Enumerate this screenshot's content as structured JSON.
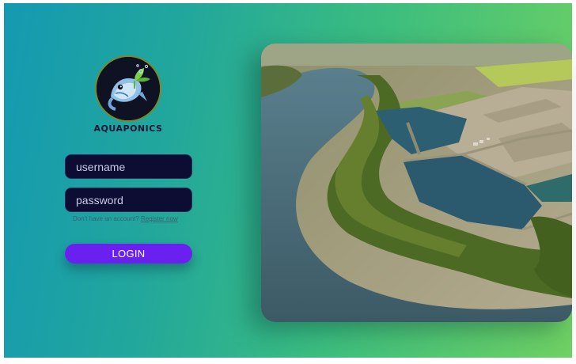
{
  "brand": {
    "name": "AQUAPONICS",
    "logo_icon": "fish-plant-logo-icon"
  },
  "login_form": {
    "username_placeholder": "username",
    "password_placeholder": "password",
    "register_prompt": "Don't have an account?",
    "register_link": "Register now",
    "login_label": "LOGIN"
  },
  "hero_image": {
    "subject": "aerial-aquaculture-ponds"
  },
  "colors": {
    "login_button": "#6a21f0",
    "input_bg": "#0d0c32",
    "gradient_start": "#1499b2",
    "gradient_end": "#6fd163"
  }
}
